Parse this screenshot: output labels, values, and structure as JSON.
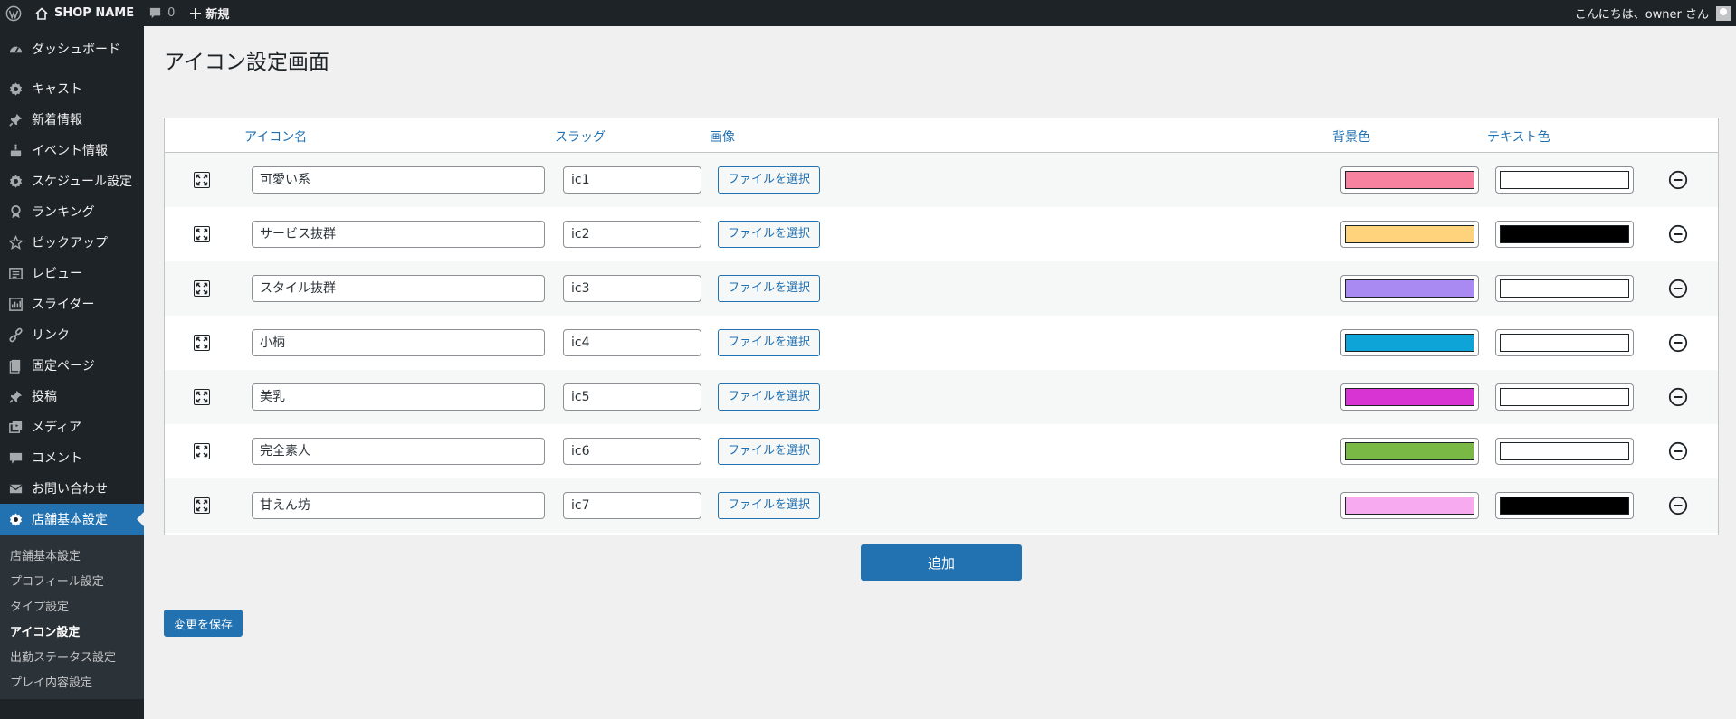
{
  "admin_bar": {
    "site_name": "SHOP NAME",
    "comment_count": "0",
    "new_label": "新規",
    "greeting": "こんにちは、owner さん"
  },
  "sidebar": {
    "items": [
      {
        "label": "ダッシュボード",
        "icon": "dashboard-icon"
      },
      {
        "label": "キャスト",
        "icon": "gear-icon"
      },
      {
        "label": "新着情報",
        "icon": "pin-icon"
      },
      {
        "label": "イベント情報",
        "icon": "cake-icon"
      },
      {
        "label": "スケジュール設定",
        "icon": "gear-icon"
      },
      {
        "label": "ランキング",
        "icon": "award-icon"
      },
      {
        "label": "ピックアップ",
        "icon": "star-icon"
      },
      {
        "label": "レビュー",
        "icon": "list-icon"
      },
      {
        "label": "スライダー",
        "icon": "chart-icon"
      },
      {
        "label": "リンク",
        "icon": "link-icon"
      },
      {
        "label": "固定ページ",
        "icon": "page-icon"
      },
      {
        "label": "投稿",
        "icon": "pin-icon"
      },
      {
        "label": "メディア",
        "icon": "media-icon"
      },
      {
        "label": "コメント",
        "icon": "comment-icon"
      },
      {
        "label": "お問い合わせ",
        "icon": "mail-icon"
      },
      {
        "label": "店舗基本設定",
        "icon": "gear-icon"
      }
    ],
    "submenu": [
      "店舗基本設定",
      "プロフィール設定",
      "タイプ設定",
      "アイコン設定",
      "出勤ステータス設定",
      "プレイ内容設定"
    ],
    "current_sub": "アイコン設定"
  },
  "page": {
    "title": "アイコン設定画面",
    "columns": {
      "name": "アイコン名",
      "slug": "スラッグ",
      "image": "画像",
      "bg": "背景色",
      "text": "テキスト色"
    },
    "file_button": "ファイルを選択",
    "rows": [
      {
        "name": "可愛い系",
        "slug": "ic1",
        "bg": "#f7829f",
        "fg": "#ffffff"
      },
      {
        "name": "サービス抜群",
        "slug": "ic2",
        "bg": "#ffd27c",
        "fg": "#000000"
      },
      {
        "name": "スタイル抜群",
        "slug": "ic3",
        "bg": "#a98af2",
        "fg": "#ffffff"
      },
      {
        "name": "小柄",
        "slug": "ic4",
        "bg": "#0fa4d8",
        "fg": "#ffffff"
      },
      {
        "name": "美乳",
        "slug": "ic5",
        "bg": "#d834d3",
        "fg": "#ffffff"
      },
      {
        "name": "完全素人",
        "slug": "ic6",
        "bg": "#7ab846",
        "fg": "#ffffff"
      },
      {
        "name": "甘えん坊",
        "slug": "ic7",
        "bg": "#f7aaf0",
        "fg": "#000000"
      }
    ],
    "add_button": "追加",
    "save_button": "変更を保存"
  }
}
